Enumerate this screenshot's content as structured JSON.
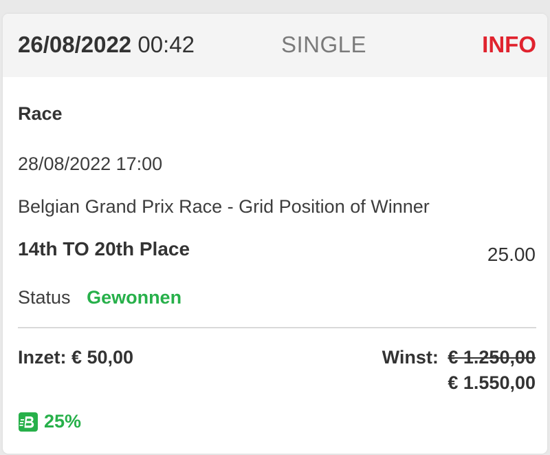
{
  "header": {
    "date": "26/08/2022",
    "time": "00:42",
    "bet_type": "SINGLE",
    "info_label": "INFO"
  },
  "bet": {
    "sport": "Race",
    "event_datetime": "28/08/2022 17:00",
    "market": "Belgian Grand Prix Race - Grid Position of Winner",
    "selection": "14th TO 20th Place",
    "odds": "25.00",
    "status_label": "Status",
    "status_value": "Gewonnen"
  },
  "footer": {
    "stake": "Inzet: € 50,00",
    "win_label": "Winst:",
    "win_old": "€ 1.250,00",
    "win_new": "€ 1.550,00",
    "boost_icon": "boost-b-icon",
    "boost_percent": "25%"
  },
  "colors": {
    "accent_red": "#e0232e",
    "success_green": "#27b04a",
    "header_bg": "#f4f4f4"
  }
}
